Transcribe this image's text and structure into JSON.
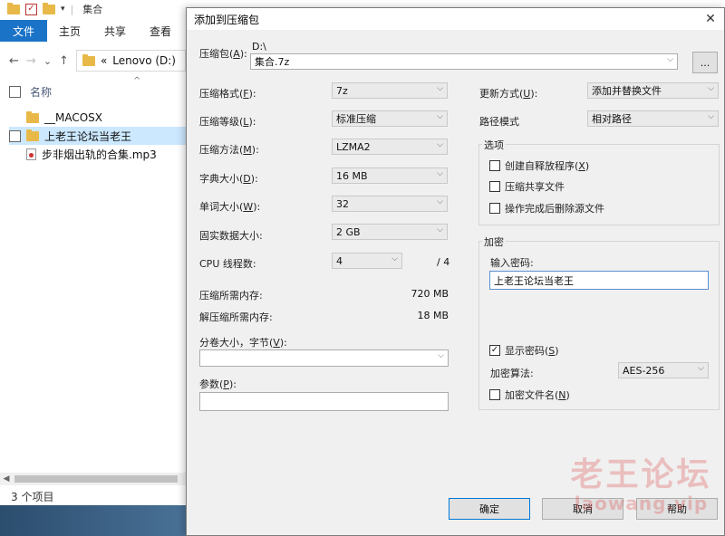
{
  "explorer": {
    "title": "集合",
    "ribbon_tabs": [
      "文件",
      "主页",
      "共享",
      "查看"
    ],
    "address_sep": "«",
    "address_path": "Lenovo (D:)",
    "column_name": "名称",
    "items": [
      "__MACOSX",
      "上老王论坛当老王",
      "步非烟出轨的合集.mp3"
    ],
    "status": "3 个项目"
  },
  "dialog": {
    "title": "添加到压缩包",
    "close_glyph": "✕",
    "archive_label": "压缩包(",
    "archive_key": "A",
    "archive_label_end": "):",
    "archive_dir": "D:\\",
    "archive_name": "集合.7z",
    "browse_label": "...",
    "format_label": "压缩格式(",
    "format_key": "F",
    "format_label_end": "):",
    "format_value": "7z",
    "level_label": "压缩等级(",
    "level_key": "L",
    "level_label_end": "):",
    "level_value": "标准压缩",
    "method_label": "压缩方法(",
    "method_key": "M",
    "method_label_end": "):",
    "method_value": "LZMA2",
    "dict_label": "字典大小(",
    "dict_key": "D",
    "dict_label_end": "):",
    "dict_value": "16 MB",
    "word_label": "单词大小(",
    "word_key": "W",
    "word_label_end": "):",
    "word_value": "32",
    "solid_label": "固实数据大小:",
    "solid_value": "2 GB",
    "cpu_label": "CPU 线程数:",
    "cpu_value": "4",
    "cpu_total": "/ 4",
    "mem_compress_label": "压缩所需内存:",
    "mem_compress_value": "720 MB",
    "mem_decompress_label": "解压缩所需内存:",
    "mem_decompress_value": "18 MB",
    "volume_label": "分卷大小，字节(",
    "volume_key": "V",
    "volume_label_end": "):",
    "volume_value": "",
    "params_label": "参数(",
    "params_key": "P",
    "params_label_end": "):",
    "params_value": "",
    "update_label": "更新方式(",
    "update_key": "U",
    "update_label_end": "):",
    "update_value": "添加并替换文件",
    "pathmode_label": "路径模式",
    "pathmode_value": "相对路径",
    "options_title": "选项",
    "opt_sfx": "创建自释放程序(",
    "opt_sfx_key": "X",
    "opt_sfx_end": ")",
    "opt_shared": "压缩共享文件",
    "opt_delete": "操作完成后删除源文件",
    "encrypt_title": "加密",
    "password_label": "输入密码:",
    "password_value": "上老王论坛当老王",
    "show_pwd_label": "显示密码(",
    "show_pwd_key": "S",
    "show_pwd_end": ")",
    "show_pwd_checked": "✓",
    "enc_method_label": "加密算法:",
    "enc_method_value": "AES-256",
    "enc_names_label": "加密文件名(",
    "enc_names_key": "N",
    "enc_names_end": ")",
    "ok_label": "确定",
    "cancel_label": "取消",
    "help_label": "帮助"
  },
  "watermark": {
    "line1": "老王论坛",
    "line2": "laowang.vip"
  },
  "icons": {
    "chevron": "⌵",
    "back": "←",
    "forward": "→",
    "down": "⌄",
    "up": "↑",
    "sort_up": "^",
    "scroll_left": "◀"
  }
}
